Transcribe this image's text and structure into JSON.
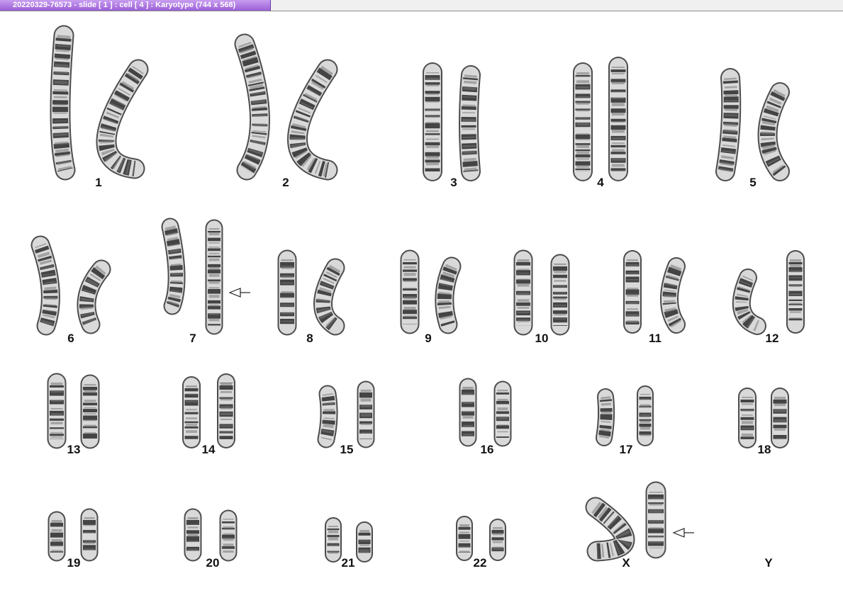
{
  "window": {
    "title": "20220329-76573 - slide [ 1 ] : cell [ 4 ] : Karyotype  (744 x 568)"
  },
  "karyotype": {
    "chromosomes": [
      {
        "label": "1",
        "count": 2,
        "arrow": false
      },
      {
        "label": "2",
        "count": 2,
        "arrow": false
      },
      {
        "label": "3",
        "count": 2,
        "arrow": false
      },
      {
        "label": "4",
        "count": 2,
        "arrow": false
      },
      {
        "label": "5",
        "count": 2,
        "arrow": false
      },
      {
        "label": "6",
        "count": 2,
        "arrow": false
      },
      {
        "label": "7",
        "count": 2,
        "arrow": true
      },
      {
        "label": "8",
        "count": 2,
        "arrow": false
      },
      {
        "label": "9",
        "count": 2,
        "arrow": false
      },
      {
        "label": "10",
        "count": 2,
        "arrow": false
      },
      {
        "label": "11",
        "count": 2,
        "arrow": false
      },
      {
        "label": "12",
        "count": 2,
        "arrow": false
      },
      {
        "label": "13",
        "count": 2,
        "arrow": false
      },
      {
        "label": "14",
        "count": 2,
        "arrow": false
      },
      {
        "label": "15",
        "count": 2,
        "arrow": false
      },
      {
        "label": "16",
        "count": 2,
        "arrow": false
      },
      {
        "label": "17",
        "count": 2,
        "arrow": false
      },
      {
        "label": "18",
        "count": 2,
        "arrow": false
      },
      {
        "label": "19",
        "count": 2,
        "arrow": false
      },
      {
        "label": "20",
        "count": 2,
        "arrow": false
      },
      {
        "label": "21",
        "count": 2,
        "arrow": false
      },
      {
        "label": "22",
        "count": 2,
        "arrow": false
      },
      {
        "label": "X",
        "count": 2,
        "arrow": true
      },
      {
        "label": "Y",
        "count": 0,
        "arrow": false
      }
    ]
  },
  "colors": {
    "title_tab": "#9a5fd6",
    "chromosome_dark": "#1a1a1a",
    "chromosome_light": "#d9d9d9"
  }
}
